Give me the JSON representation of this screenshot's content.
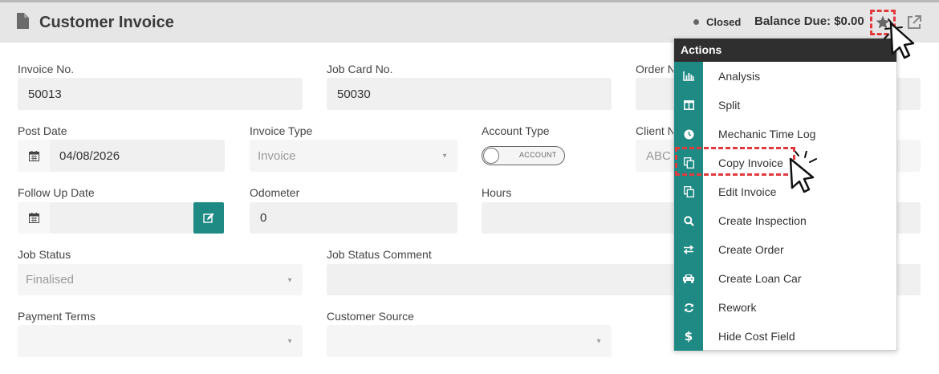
{
  "header": {
    "title": "Customer Invoice",
    "status": "Closed",
    "balance": "Balance Due: $0.00",
    "icons": [
      "document-icon",
      "star-icon",
      "external-link-icon"
    ]
  },
  "form": {
    "invoice_no": {
      "label": "Invoice No.",
      "value": "50013"
    },
    "job_card_no": {
      "label": "Job Card No.",
      "value": "50030"
    },
    "order_no": {
      "label": "Order N"
    },
    "post_date": {
      "label": "Post Date",
      "value": "04/08/2026"
    },
    "invoice_type": {
      "label": "Invoice Type",
      "value": "Invoice"
    },
    "account_type": {
      "label": "Account Type",
      "toggle_text": "ACCOUNT"
    },
    "client_no": {
      "label": "Client N",
      "value": "ABC"
    },
    "follow_up_date": {
      "label": "Follow Up Date",
      "value": ""
    },
    "odometer": {
      "label": "Odometer",
      "value": "0"
    },
    "hours": {
      "label": "Hours",
      "value": ""
    },
    "job_status": {
      "label": "Job Status",
      "value": "Finalised"
    },
    "job_status_comment": {
      "label": "Job Status Comment",
      "value": ""
    },
    "payment_terms": {
      "label": "Payment Terms",
      "value": ""
    },
    "customer_source": {
      "label": "Customer Source",
      "value": ""
    }
  },
  "actions_menu": {
    "title": "Actions",
    "items": [
      {
        "label": "Analysis",
        "icon": "bar-chart-icon"
      },
      {
        "label": "Split",
        "icon": "columns-icon"
      },
      {
        "label": "Mechanic Time Log",
        "icon": "clock-icon"
      },
      {
        "label": "Copy Invoice",
        "icon": "copy-icon"
      },
      {
        "label": "Edit Invoice",
        "icon": "copy-icon"
      },
      {
        "label": "Create Inspection",
        "icon": "search-icon"
      },
      {
        "label": "Create Order",
        "icon": "exchange-icon"
      },
      {
        "label": "Create Loan Car",
        "icon": "car-icon"
      },
      {
        "label": "Rework",
        "icon": "refresh-icon"
      },
      {
        "label": "Hide Cost Field",
        "icon": "dollar-icon"
      }
    ]
  },
  "colors": {
    "teal": "#1f8a84",
    "highlight": "#e2393f",
    "header_bg": "#e6e6e6",
    "menu_header": "#2f2f2f"
  }
}
